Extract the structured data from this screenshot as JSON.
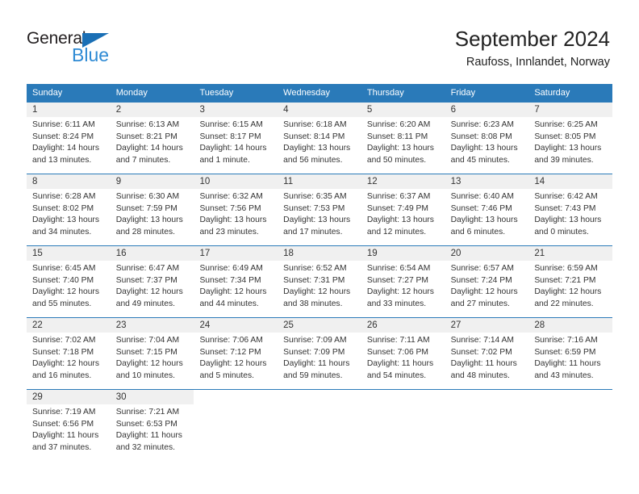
{
  "brand": {
    "name_top": "General",
    "name_bottom": "Blue",
    "accent_color": "#2e8ad4",
    "triangle_color": "#1a6fb5"
  },
  "header": {
    "title": "September 2024",
    "subtitle": "Raufoss, Innlandet, Norway"
  },
  "theme": {
    "header_blue": "#2a7ab9",
    "daynum_band": "#f0f0f0",
    "text": "#333333"
  },
  "weekday_headers": [
    "Sunday",
    "Monday",
    "Tuesday",
    "Wednesday",
    "Thursday",
    "Friday",
    "Saturday"
  ],
  "weeks": [
    [
      {
        "day": "1",
        "sunrise": "Sunrise: 6:11 AM",
        "sunset": "Sunset: 8:24 PM",
        "daylight_1": "Daylight: 14 hours",
        "daylight_2": "and 13 minutes."
      },
      {
        "day": "2",
        "sunrise": "Sunrise: 6:13 AM",
        "sunset": "Sunset: 8:21 PM",
        "daylight_1": "Daylight: 14 hours",
        "daylight_2": "and 7 minutes."
      },
      {
        "day": "3",
        "sunrise": "Sunrise: 6:15 AM",
        "sunset": "Sunset: 8:17 PM",
        "daylight_1": "Daylight: 14 hours",
        "daylight_2": "and 1 minute."
      },
      {
        "day": "4",
        "sunrise": "Sunrise: 6:18 AM",
        "sunset": "Sunset: 8:14 PM",
        "daylight_1": "Daylight: 13 hours",
        "daylight_2": "and 56 minutes."
      },
      {
        "day": "5",
        "sunrise": "Sunrise: 6:20 AM",
        "sunset": "Sunset: 8:11 PM",
        "daylight_1": "Daylight: 13 hours",
        "daylight_2": "and 50 minutes."
      },
      {
        "day": "6",
        "sunrise": "Sunrise: 6:23 AM",
        "sunset": "Sunset: 8:08 PM",
        "daylight_1": "Daylight: 13 hours",
        "daylight_2": "and 45 minutes."
      },
      {
        "day": "7",
        "sunrise": "Sunrise: 6:25 AM",
        "sunset": "Sunset: 8:05 PM",
        "daylight_1": "Daylight: 13 hours",
        "daylight_2": "and 39 minutes."
      }
    ],
    [
      {
        "day": "8",
        "sunrise": "Sunrise: 6:28 AM",
        "sunset": "Sunset: 8:02 PM",
        "daylight_1": "Daylight: 13 hours",
        "daylight_2": "and 34 minutes."
      },
      {
        "day": "9",
        "sunrise": "Sunrise: 6:30 AM",
        "sunset": "Sunset: 7:59 PM",
        "daylight_1": "Daylight: 13 hours",
        "daylight_2": "and 28 minutes."
      },
      {
        "day": "10",
        "sunrise": "Sunrise: 6:32 AM",
        "sunset": "Sunset: 7:56 PM",
        "daylight_1": "Daylight: 13 hours",
        "daylight_2": "and 23 minutes."
      },
      {
        "day": "11",
        "sunrise": "Sunrise: 6:35 AM",
        "sunset": "Sunset: 7:53 PM",
        "daylight_1": "Daylight: 13 hours",
        "daylight_2": "and 17 minutes."
      },
      {
        "day": "12",
        "sunrise": "Sunrise: 6:37 AM",
        "sunset": "Sunset: 7:49 PM",
        "daylight_1": "Daylight: 13 hours",
        "daylight_2": "and 12 minutes."
      },
      {
        "day": "13",
        "sunrise": "Sunrise: 6:40 AM",
        "sunset": "Sunset: 7:46 PM",
        "daylight_1": "Daylight: 13 hours",
        "daylight_2": "and 6 minutes."
      },
      {
        "day": "14",
        "sunrise": "Sunrise: 6:42 AM",
        "sunset": "Sunset: 7:43 PM",
        "daylight_1": "Daylight: 13 hours",
        "daylight_2": "and 0 minutes."
      }
    ],
    [
      {
        "day": "15",
        "sunrise": "Sunrise: 6:45 AM",
        "sunset": "Sunset: 7:40 PM",
        "daylight_1": "Daylight: 12 hours",
        "daylight_2": "and 55 minutes."
      },
      {
        "day": "16",
        "sunrise": "Sunrise: 6:47 AM",
        "sunset": "Sunset: 7:37 PM",
        "daylight_1": "Daylight: 12 hours",
        "daylight_2": "and 49 minutes."
      },
      {
        "day": "17",
        "sunrise": "Sunrise: 6:49 AM",
        "sunset": "Sunset: 7:34 PM",
        "daylight_1": "Daylight: 12 hours",
        "daylight_2": "and 44 minutes."
      },
      {
        "day": "18",
        "sunrise": "Sunrise: 6:52 AM",
        "sunset": "Sunset: 7:31 PM",
        "daylight_1": "Daylight: 12 hours",
        "daylight_2": "and 38 minutes."
      },
      {
        "day": "19",
        "sunrise": "Sunrise: 6:54 AM",
        "sunset": "Sunset: 7:27 PM",
        "daylight_1": "Daylight: 12 hours",
        "daylight_2": "and 33 minutes."
      },
      {
        "day": "20",
        "sunrise": "Sunrise: 6:57 AM",
        "sunset": "Sunset: 7:24 PM",
        "daylight_1": "Daylight: 12 hours",
        "daylight_2": "and 27 minutes."
      },
      {
        "day": "21",
        "sunrise": "Sunrise: 6:59 AM",
        "sunset": "Sunset: 7:21 PM",
        "daylight_1": "Daylight: 12 hours",
        "daylight_2": "and 22 minutes."
      }
    ],
    [
      {
        "day": "22",
        "sunrise": "Sunrise: 7:02 AM",
        "sunset": "Sunset: 7:18 PM",
        "daylight_1": "Daylight: 12 hours",
        "daylight_2": "and 16 minutes."
      },
      {
        "day": "23",
        "sunrise": "Sunrise: 7:04 AM",
        "sunset": "Sunset: 7:15 PM",
        "daylight_1": "Daylight: 12 hours",
        "daylight_2": "and 10 minutes."
      },
      {
        "day": "24",
        "sunrise": "Sunrise: 7:06 AM",
        "sunset": "Sunset: 7:12 PM",
        "daylight_1": "Daylight: 12 hours",
        "daylight_2": "and 5 minutes."
      },
      {
        "day": "25",
        "sunrise": "Sunrise: 7:09 AM",
        "sunset": "Sunset: 7:09 PM",
        "daylight_1": "Daylight: 11 hours",
        "daylight_2": "and 59 minutes."
      },
      {
        "day": "26",
        "sunrise": "Sunrise: 7:11 AM",
        "sunset": "Sunset: 7:06 PM",
        "daylight_1": "Daylight: 11 hours",
        "daylight_2": "and 54 minutes."
      },
      {
        "day": "27",
        "sunrise": "Sunrise: 7:14 AM",
        "sunset": "Sunset: 7:02 PM",
        "daylight_1": "Daylight: 11 hours",
        "daylight_2": "and 48 minutes."
      },
      {
        "day": "28",
        "sunrise": "Sunrise: 7:16 AM",
        "sunset": "Sunset: 6:59 PM",
        "daylight_1": "Daylight: 11 hours",
        "daylight_2": "and 43 minutes."
      }
    ],
    [
      {
        "day": "29",
        "sunrise": "Sunrise: 7:19 AM",
        "sunset": "Sunset: 6:56 PM",
        "daylight_1": "Daylight: 11 hours",
        "daylight_2": "and 37 minutes."
      },
      {
        "day": "30",
        "sunrise": "Sunrise: 7:21 AM",
        "sunset": "Sunset: 6:53 PM",
        "daylight_1": "Daylight: 11 hours",
        "daylight_2": "and 32 minutes."
      },
      {
        "day": "",
        "sunrise": "",
        "sunset": "",
        "daylight_1": "",
        "daylight_2": ""
      },
      {
        "day": "",
        "sunrise": "",
        "sunset": "",
        "daylight_1": "",
        "daylight_2": ""
      },
      {
        "day": "",
        "sunrise": "",
        "sunset": "",
        "daylight_1": "",
        "daylight_2": ""
      },
      {
        "day": "",
        "sunrise": "",
        "sunset": "",
        "daylight_1": "",
        "daylight_2": ""
      },
      {
        "day": "",
        "sunrise": "",
        "sunset": "",
        "daylight_1": "",
        "daylight_2": ""
      }
    ]
  ]
}
